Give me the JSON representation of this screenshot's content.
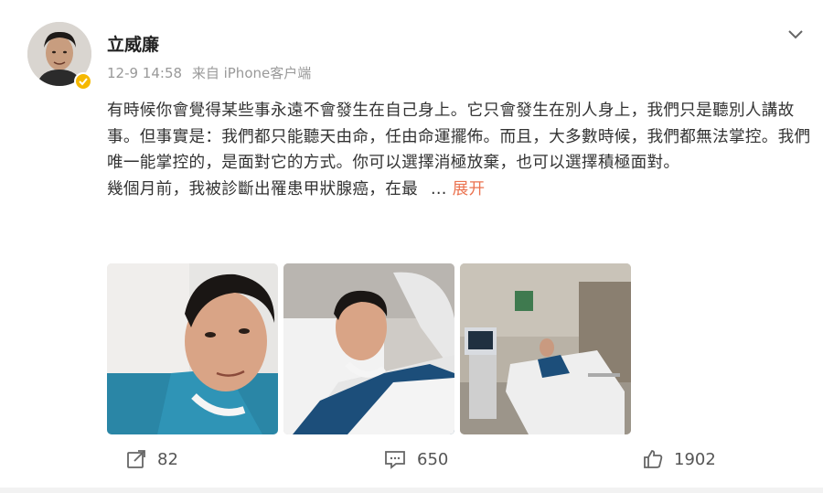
{
  "post": {
    "username": "立威廉",
    "timestamp": "12-9 14:58",
    "source": "来自 iPhone客户端",
    "paragraph1": "有時候你會覺得某些事永遠不會發生在自己身上。它只會發生在別人身上，我們只是聽別人講故事。但事實是：我們都只能聽天由命，任由命運擺佈。而且，大多數時候，我們都無法掌控。我們唯一能掌控的，是面對它的方式。你可以選擇消極放棄，也可以選擇積極面對。",
    "paragraph2": "幾個月前，我被診斷出罹患甲狀腺癌，在最",
    "ellipsis": "...",
    "expand_label": "展开",
    "verified": true,
    "photos": [
      {
        "icon": "photo-selfie-hospital"
      },
      {
        "icon": "photo-lying-bed"
      },
      {
        "icon": "photo-hospital-room"
      }
    ]
  },
  "actions": {
    "repost_count": "82",
    "comment_count": "650",
    "like_count": "1902"
  },
  "colors": {
    "accent": "#eb7350",
    "verified_badge": "#f5b800",
    "meta_text": "#999999"
  }
}
